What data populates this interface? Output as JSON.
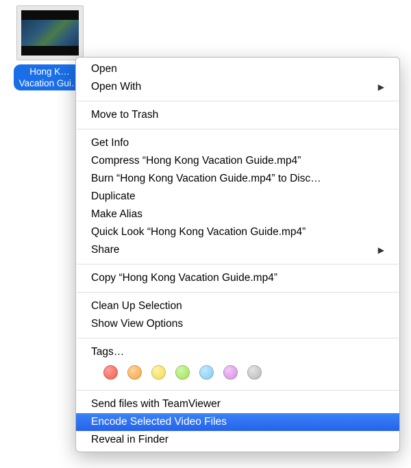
{
  "file": {
    "label_line1": "Hong K…",
    "label_line2": "Vacation Gui…"
  },
  "menu": {
    "open": "Open",
    "open_with": "Open With",
    "move_to_trash": "Move to Trash",
    "get_info": "Get Info",
    "compress": "Compress “Hong Kong Vacation Guide.mp4”",
    "burn": "Burn “Hong Kong Vacation Guide.mp4” to Disc…",
    "duplicate": "Duplicate",
    "make_alias": "Make Alias",
    "quick_look": "Quick Look “Hong Kong Vacation Guide.mp4”",
    "share": "Share",
    "copy": "Copy “Hong Kong Vacation Guide.mp4”",
    "clean_up": "Clean Up Selection",
    "view_options": "Show View Options",
    "tags": "Tags…",
    "teamviewer": "Send files with TeamViewer",
    "encode": "Encode Selected Video Files",
    "reveal": "Reveal in Finder"
  },
  "tag_colors": [
    "red",
    "orange",
    "yellow",
    "green",
    "blue",
    "purple",
    "gray"
  ]
}
